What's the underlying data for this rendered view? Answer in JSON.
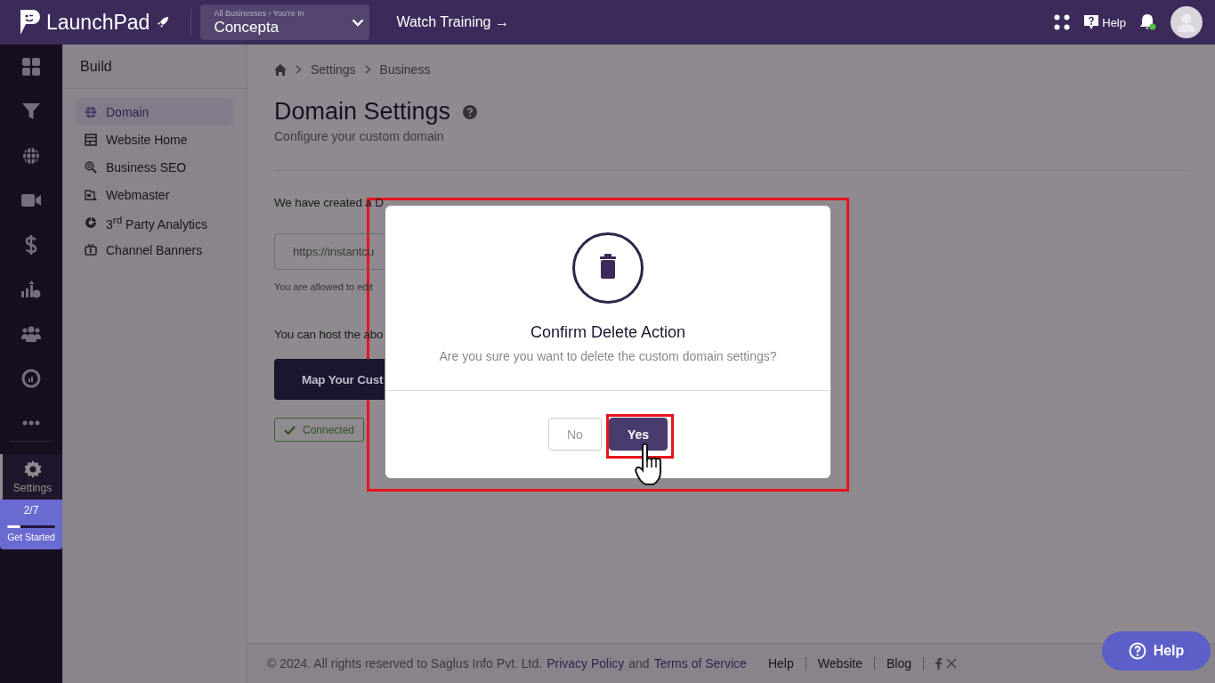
{
  "topbar": {
    "logo": "LaunchPad",
    "business_switcher": {
      "path": "All Businesses › You're In",
      "value": "Concepta"
    },
    "watch_training": "Watch Training →",
    "help": "Help"
  },
  "rail": {
    "items": [
      {
        "kind": "grid",
        "selected": false
      },
      {
        "kind": "funnel",
        "selected": false
      },
      {
        "kind": "globe",
        "selected": false
      },
      {
        "kind": "video",
        "selected": false
      },
      {
        "kind": "dollar",
        "selected": false
      },
      {
        "kind": "chart",
        "selected": false
      },
      {
        "kind": "team",
        "selected": false
      },
      {
        "kind": "gauge",
        "selected": false
      },
      {
        "kind": "more",
        "selected": false
      },
      {
        "kind": "settings",
        "label": "Settings",
        "selected": true
      }
    ],
    "progress": {
      "count": "2/7",
      "level": 0.28,
      "label": "Get Started"
    }
  },
  "sidebar": {
    "title": "Build",
    "items": [
      {
        "kind": "globe",
        "label": "Domain",
        "selected": true
      },
      {
        "kind": "layout",
        "label": "Website Home",
        "selected": false
      },
      {
        "kind": "search",
        "label": "Business SEO",
        "selected": false
      },
      {
        "kind": "webmaster",
        "label": "Webmaster",
        "selected": false
      },
      {
        "kind": "analytics",
        "label": "3$^{rd}$ Party Analytics",
        "selected": false
      },
      {
        "kind": "banner",
        "label": "Channel Banners",
        "selected": false
      }
    ]
  },
  "breadcrumb": [
    "Settings",
    "Business"
  ],
  "page": {
    "title": "Domain Settings",
    "subtitle": "Configure your custom domain",
    "intro": "We have created a D",
    "url_field": "https://instantcu",
    "hint": "You are allowed to edit",
    "host_text": "You can host the abo",
    "map_button": "Map Your Cust",
    "status_badge": "Connected"
  },
  "modal": {
    "title": "Confirm Delete Action",
    "message": "Are you sure you want to delete the custom domain settings?",
    "buttons": [
      {
        "label": "No",
        "kind": "secondary"
      },
      {
        "label": "Yes",
        "kind": "primary"
      }
    ]
  },
  "footer": {
    "copyright": "©  2024. All rights reserved to Saglus Info Pvt. Ltd.",
    "privacy": "Privacy Policy",
    "and": "and",
    "terms": "Terms of Service",
    "links": [
      "Help",
      "Website",
      "Blog"
    ]
  },
  "help_button": "Help"
}
